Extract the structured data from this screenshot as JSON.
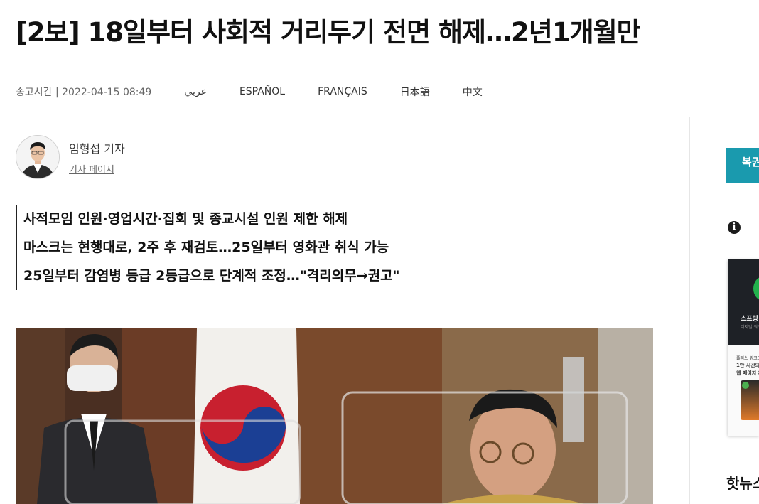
{
  "article": {
    "headline": "[2보] 18일부터 사회적 거리두기 전면 해제…2년1개월만",
    "send_time": "송고시간 | 2022-04-15 08:49"
  },
  "languages": [
    "عربي",
    "ESPAÑOL",
    "FRANÇAIS",
    "日本語",
    "中文"
  ],
  "reporter": {
    "name": "임형섭 기자",
    "page_link": "기자 페이지"
  },
  "summary": [
    "사적모임 인원·영업시간·집회 및 종교시설 인원 제한 해제",
    "마스크는 현행대로, 2주 후 재검토…25일부터 영화관 취식 가능",
    "25일부터 감염병 등급 2등급으로 단계적 조정…\"격리의무→권고\""
  ],
  "sidebar": {
    "button_label": "복권",
    "info_icon": "i",
    "ad": {
      "title": "스프링",
      "subtitle": "디지털 워크",
      "line1": "플러스 워크그룹",
      "line2": "1만 시간의",
      "line3": "웹 페이지 제작"
    },
    "section_heading": "핫뉴스"
  },
  "colors": {
    "accent": "#1a9aae",
    "text": "#111111"
  }
}
